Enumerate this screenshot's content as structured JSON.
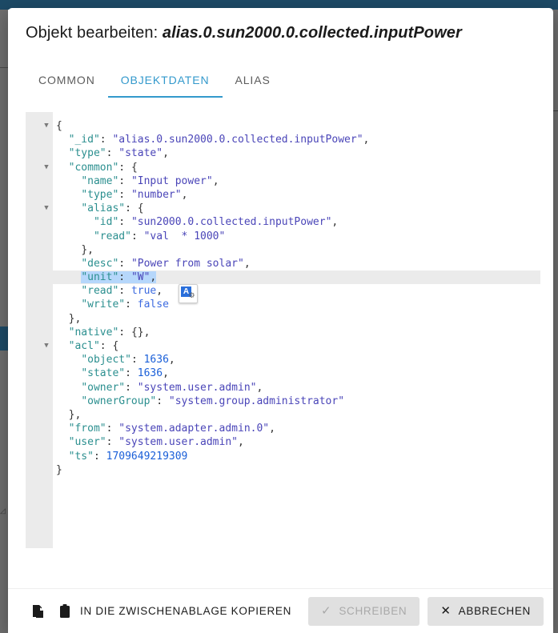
{
  "background": {
    "sidebar_glyph": "◿"
  },
  "dialog": {
    "title_prefix": "Objekt bearbeiten:",
    "object_id": "alias.0.sun2000.0.collected.inputPower",
    "tabs": [
      {
        "label": "COMMON",
        "active": false
      },
      {
        "label": "OBJEKTDATEN",
        "active": true
      },
      {
        "label": "ALIAS",
        "active": false
      }
    ]
  },
  "editor": {
    "language": "json",
    "active_line_index": 11,
    "selected_text": "\"unit\": \"W\",",
    "lines": [
      {
        "fold": true,
        "indent": 0,
        "tokens": [
          {
            "t": "punct",
            "v": "{"
          }
        ]
      },
      {
        "fold": false,
        "indent": 1,
        "tokens": [
          {
            "t": "key",
            "v": "\"_id\""
          },
          {
            "t": "colon",
            "v": ": "
          },
          {
            "t": "string",
            "v": "\"alias.0.sun2000.0.collected.inputPower\""
          },
          {
            "t": "punct",
            "v": ","
          }
        ]
      },
      {
        "fold": false,
        "indent": 1,
        "tokens": [
          {
            "t": "key",
            "v": "\"type\""
          },
          {
            "t": "colon",
            "v": ": "
          },
          {
            "t": "string",
            "v": "\"state\""
          },
          {
            "t": "punct",
            "v": ","
          }
        ]
      },
      {
        "fold": true,
        "indent": 1,
        "tokens": [
          {
            "t": "key",
            "v": "\"common\""
          },
          {
            "t": "colon",
            "v": ": "
          },
          {
            "t": "punct",
            "v": "{"
          }
        ]
      },
      {
        "fold": false,
        "indent": 2,
        "tokens": [
          {
            "t": "key",
            "v": "\"name\""
          },
          {
            "t": "colon",
            "v": ": "
          },
          {
            "t": "string",
            "v": "\"Input power\""
          },
          {
            "t": "punct",
            "v": ","
          }
        ]
      },
      {
        "fold": false,
        "indent": 2,
        "tokens": [
          {
            "t": "key",
            "v": "\"type\""
          },
          {
            "t": "colon",
            "v": ": "
          },
          {
            "t": "string",
            "v": "\"number\""
          },
          {
            "t": "punct",
            "v": ","
          }
        ]
      },
      {
        "fold": true,
        "indent": 2,
        "tokens": [
          {
            "t": "key",
            "v": "\"alias\""
          },
          {
            "t": "colon",
            "v": ": "
          },
          {
            "t": "punct",
            "v": "{"
          }
        ]
      },
      {
        "fold": false,
        "indent": 3,
        "tokens": [
          {
            "t": "key",
            "v": "\"id\""
          },
          {
            "t": "colon",
            "v": ": "
          },
          {
            "t": "string",
            "v": "\"sun2000.0.collected.inputPower\""
          },
          {
            "t": "punct",
            "v": ","
          }
        ]
      },
      {
        "fold": false,
        "indent": 3,
        "tokens": [
          {
            "t": "key",
            "v": "\"read\""
          },
          {
            "t": "colon",
            "v": ": "
          },
          {
            "t": "string",
            "v": "\"val  * 1000\""
          }
        ]
      },
      {
        "fold": false,
        "indent": 2,
        "tokens": [
          {
            "t": "punct",
            "v": "},"
          }
        ]
      },
      {
        "fold": false,
        "indent": 2,
        "tokens": [
          {
            "t": "key",
            "v": "\"desc\""
          },
          {
            "t": "colon",
            "v": ": "
          },
          {
            "t": "string",
            "v": "\"Power from solar\""
          },
          {
            "t": "punct",
            "v": ","
          }
        ]
      },
      {
        "fold": false,
        "indent": 2,
        "selected": true,
        "tokens": [
          {
            "t": "key",
            "v": "\"unit\""
          },
          {
            "t": "colon",
            "v": ": "
          },
          {
            "t": "string",
            "v": "\"W\""
          },
          {
            "t": "punct",
            "v": ","
          }
        ]
      },
      {
        "fold": false,
        "indent": 2,
        "tokens": [
          {
            "t": "key",
            "v": "\"read\""
          },
          {
            "t": "colon",
            "v": ": "
          },
          {
            "t": "bool",
            "v": "true"
          },
          {
            "t": "punct",
            "v": ","
          }
        ]
      },
      {
        "fold": false,
        "indent": 2,
        "tokens": [
          {
            "t": "key",
            "v": "\"write\""
          },
          {
            "t": "colon",
            "v": ": "
          },
          {
            "t": "bool",
            "v": "false"
          }
        ]
      },
      {
        "fold": false,
        "indent": 1,
        "tokens": [
          {
            "t": "punct",
            "v": "},"
          }
        ]
      },
      {
        "fold": false,
        "indent": 1,
        "tokens": [
          {
            "t": "key",
            "v": "\"native\""
          },
          {
            "t": "colon",
            "v": ": "
          },
          {
            "t": "punct",
            "v": "{},"
          }
        ]
      },
      {
        "fold": true,
        "indent": 1,
        "tokens": [
          {
            "t": "key",
            "v": "\"acl\""
          },
          {
            "t": "colon",
            "v": ": "
          },
          {
            "t": "punct",
            "v": "{"
          }
        ]
      },
      {
        "fold": false,
        "indent": 2,
        "tokens": [
          {
            "t": "key",
            "v": "\"object\""
          },
          {
            "t": "colon",
            "v": ": "
          },
          {
            "t": "number",
            "v": "1636"
          },
          {
            "t": "punct",
            "v": ","
          }
        ]
      },
      {
        "fold": false,
        "indent": 2,
        "tokens": [
          {
            "t": "key",
            "v": "\"state\""
          },
          {
            "t": "colon",
            "v": ": "
          },
          {
            "t": "number",
            "v": "1636"
          },
          {
            "t": "punct",
            "v": ","
          }
        ]
      },
      {
        "fold": false,
        "indent": 2,
        "tokens": [
          {
            "t": "key",
            "v": "\"owner\""
          },
          {
            "t": "colon",
            "v": ": "
          },
          {
            "t": "string",
            "v": "\"system.user.admin\""
          },
          {
            "t": "punct",
            "v": ","
          }
        ]
      },
      {
        "fold": false,
        "indent": 2,
        "tokens": [
          {
            "t": "key",
            "v": "\"ownerGroup\""
          },
          {
            "t": "colon",
            "v": ": "
          },
          {
            "t": "string",
            "v": "\"system.group.administrator\""
          }
        ]
      },
      {
        "fold": false,
        "indent": 1,
        "tokens": [
          {
            "t": "punct",
            "v": "},"
          }
        ]
      },
      {
        "fold": false,
        "indent": 1,
        "tokens": [
          {
            "t": "key",
            "v": "\"from\""
          },
          {
            "t": "colon",
            "v": ": "
          },
          {
            "t": "string",
            "v": "\"system.adapter.admin.0\""
          },
          {
            "t": "punct",
            "v": ","
          }
        ]
      },
      {
        "fold": false,
        "indent": 1,
        "tokens": [
          {
            "t": "key",
            "v": "\"user\""
          },
          {
            "t": "colon",
            "v": ": "
          },
          {
            "t": "string",
            "v": "\"system.user.admin\""
          },
          {
            "t": "punct",
            "v": ","
          }
        ]
      },
      {
        "fold": false,
        "indent": 1,
        "tokens": [
          {
            "t": "key",
            "v": "\"ts\""
          },
          {
            "t": "colon",
            "v": ": "
          },
          {
            "t": "number",
            "v": "1709649219309"
          }
        ]
      },
      {
        "fold": false,
        "indent": 0,
        "tokens": [
          {
            "t": "punct",
            "v": "}"
          }
        ]
      }
    ]
  },
  "translate_popup": {
    "letter": "A",
    "glyph": "⚙"
  },
  "bottom_bar": {
    "copy_file_icon": "copy-file-icon",
    "clipboard_icon": "clipboard-icon",
    "copy_to_clipboard_label": "IN DIE ZWISCHENABLAGE KOPIEREN",
    "write_label": "SCHREIBEN",
    "write_glyph": "✓",
    "write_disabled": true,
    "cancel_label": "ABBRECHEN",
    "cancel_glyph": "✕"
  },
  "colors": {
    "accent": "#3399cc",
    "topbar": "#1d4a66",
    "key": "#2b8f8f",
    "string": "#4a45b8",
    "number": "#1a5fd8",
    "boolean": "#3d6be0",
    "selection": "#b6d7fb",
    "gutter": "#ebebeb"
  }
}
